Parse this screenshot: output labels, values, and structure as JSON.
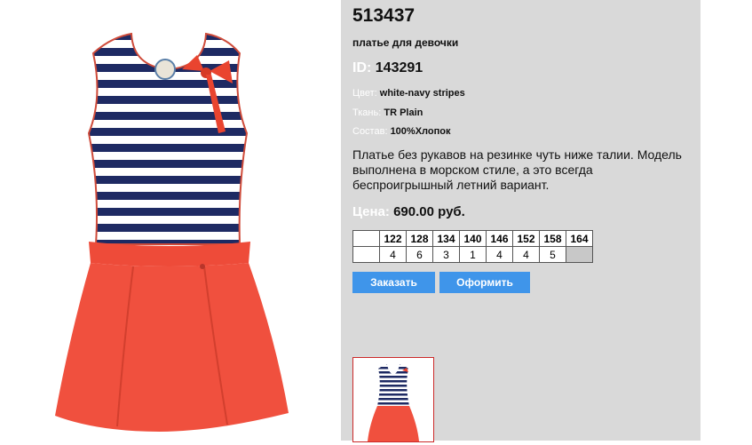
{
  "product": {
    "code": "513437",
    "name": "платье для девочки",
    "id_label": "ID:",
    "id_value": "143291",
    "attributes": [
      {
        "label": "Цвет:",
        "value": "white-navy stripes"
      },
      {
        "label": "Ткань:",
        "value": "TR Plain"
      },
      {
        "label": "Состав:",
        "value": "100%Хлопок"
      }
    ],
    "description": "Платье без рукавов на резинке чуть ниже талии. Модель выполнена в морском стиле, а это всегда беспроигрышный летний вариант.",
    "price_label": "Цена:",
    "price_value": "690.00 руб."
  },
  "sizes": {
    "headers": [
      "",
      "122",
      "128",
      "134",
      "140",
      "146",
      "152",
      "158",
      "164"
    ],
    "quantities": [
      "",
      "4",
      "6",
      "3",
      "1",
      "4",
      "4",
      "5",
      ""
    ]
  },
  "buttons": {
    "order": "Заказать",
    "checkout": "Оформить"
  },
  "colors": {
    "panel_bg": "#d9d9d9",
    "button_bg": "#3f95ea",
    "stripe_navy": "#1e2a63",
    "skirt_coral": "#f0503e"
  },
  "icons": [
    "dress-product-image",
    "dress-thumbnail-image"
  ]
}
